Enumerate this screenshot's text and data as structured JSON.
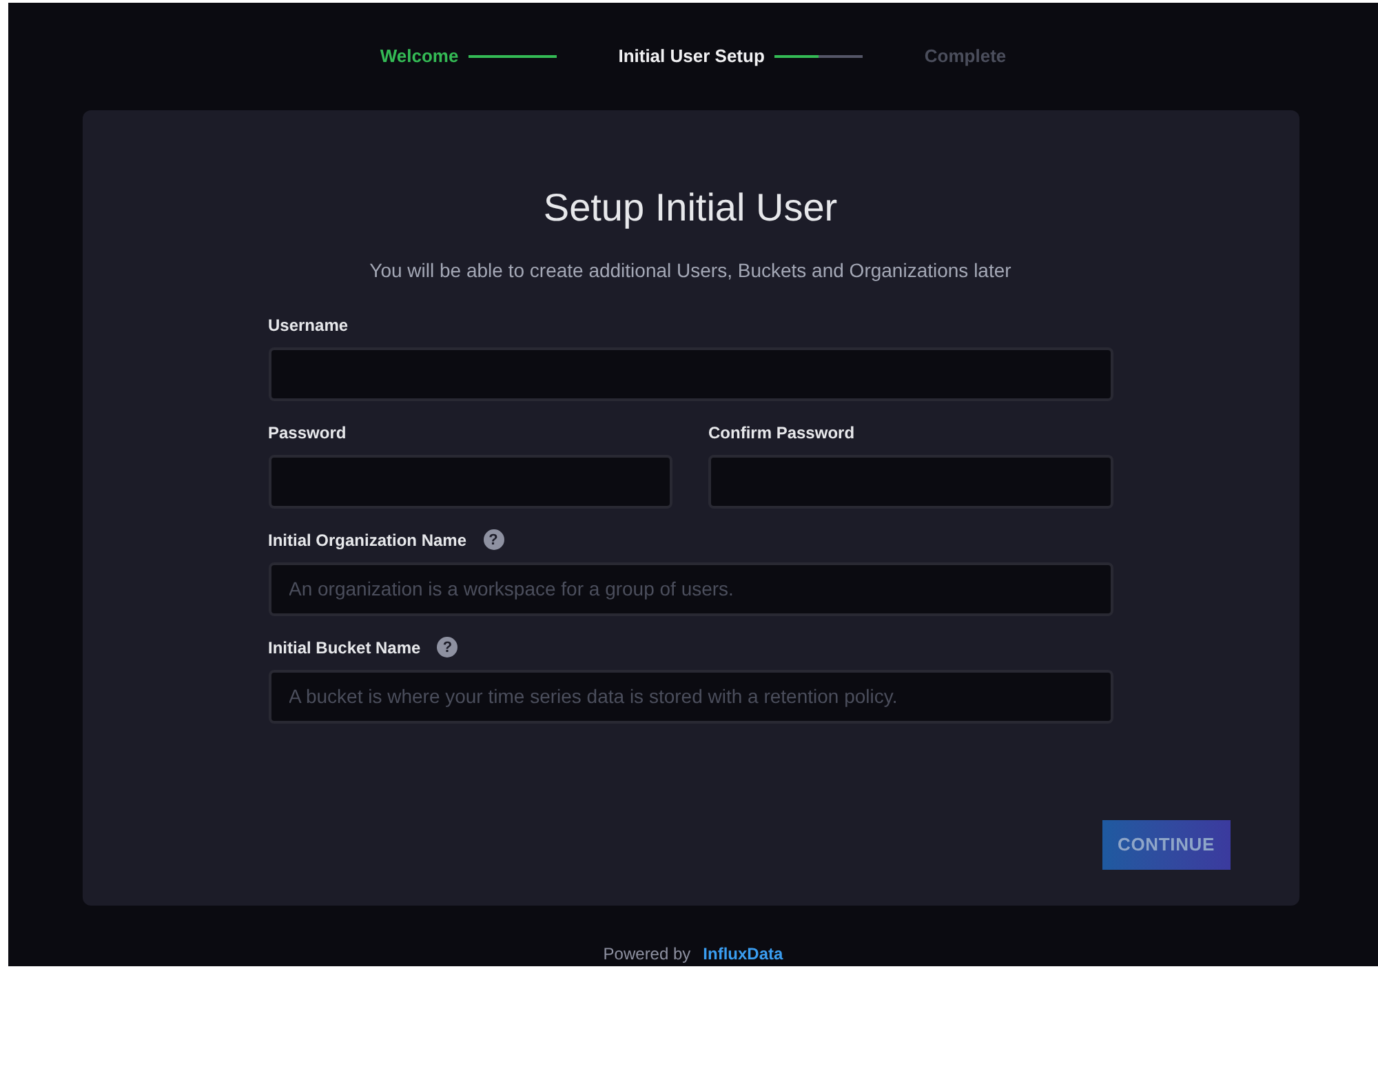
{
  "steps": [
    {
      "label": "Welcome",
      "completed": true,
      "selected": false,
      "connector": {
        "level": 1
      }
    },
    {
      "label": "Initial User Setup",
      "completed": false,
      "selected": true,
      "connector": {
        "level": 0.5
      }
    },
    {
      "label": "Complete",
      "completed": false,
      "selected": false
    }
  ],
  "card": {
    "title": "Setup Initial User",
    "subtitle": "You will be able to create additional Users, Buckets and Organizations later",
    "field_rows": [
      [
        {
          "label": "Username"
        }
      ],
      [
        {
          "label": "Password"
        },
        {
          "label": "Confirm Password"
        }
      ],
      [
        {
          "label": "Initial Organization Name",
          "help_icon": "?",
          "placeholder": "An organization is a workspace for a group of users."
        }
      ],
      [
        {
          "label": "Initial Bucket Name",
          "help_icon": "?",
          "placeholder": "A bucket is where your time series data is stored with a retention policy."
        }
      ]
    ],
    "button": {
      "label": "CONTINUE",
      "disabled": true
    }
  },
  "footer": {
    "text": "Powered by",
    "link": "InfluxData"
  }
}
